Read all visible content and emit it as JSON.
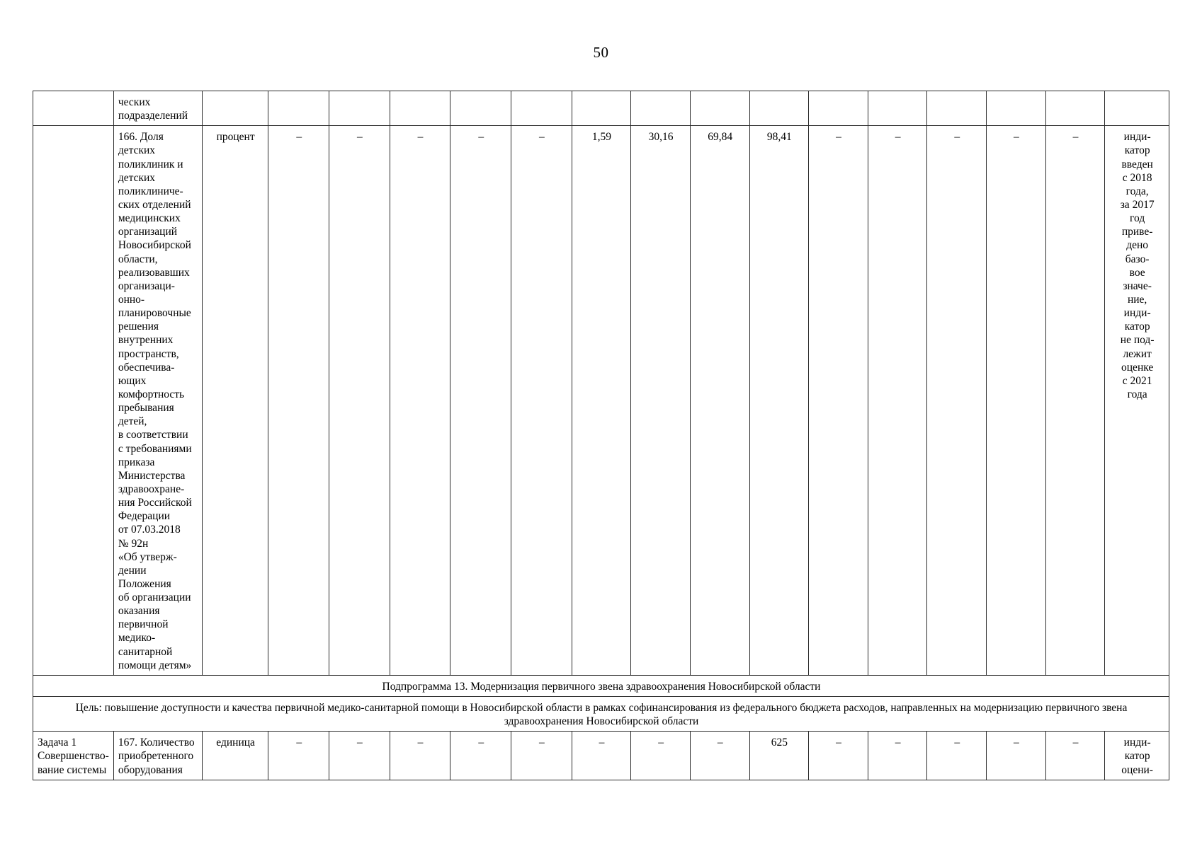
{
  "page": {
    "number": "50"
  },
  "table": {
    "columns": [
      "task",
      "indicator",
      "unit",
      "y1",
      "y2",
      "y3",
      "y4",
      "y5",
      "y6",
      "y7",
      "y8",
      "y9",
      "y10",
      "y11",
      "y12",
      "y13",
      "y14",
      "note"
    ],
    "rows": [
      {
        "id": "row-continuation",
        "task": "",
        "indicator_lines": [
          "ческих",
          "подразделений"
        ],
        "unit": "",
        "values": [
          "",
          "",
          "",
          "",
          "",
          "",
          "",
          "",
          "",
          "",
          "",
          "",
          "",
          ""
        ],
        "note_lines": []
      },
      {
        "id": "row-166",
        "task": "",
        "indicator_lines": [
          "166. Доля",
          "детских",
          "поликлиник и",
          "детских",
          "поликлиниче-",
          "ских отделений",
          "медицинских",
          "организаций",
          "Новосибирской",
          "области,",
          "реализовавших",
          "организаци-",
          "онно-",
          "планировочные",
          "решения",
          "внутренних",
          "пространств,",
          "обеспечива-",
          "ющих",
          "комфортность",
          "пребывания",
          "детей,",
          "в соответствии",
          "с требованиями",
          "приказа",
          "Министерства",
          "здравоохране-",
          "ния Российской",
          "Федерации",
          "от 07.03.2018",
          "№ 92н",
          "«Об утверж-",
          "дении",
          "Положения",
          "об организации",
          "оказания",
          "первичной",
          "медико-",
          "санитарной",
          "помощи детям»"
        ],
        "unit": "процент",
        "values": [
          "–",
          "–",
          "–",
          "–",
          "–",
          "1,59",
          "30,16",
          "69,84",
          "98,41",
          "–",
          "–",
          "–",
          "–",
          "–"
        ],
        "note_lines": [
          "инди-",
          "катор",
          "введен",
          "с 2018",
          "года,",
          "за 2017",
          "год",
          "приве-",
          "дено",
          "базо-",
          "вое",
          "значе-",
          "ние,",
          "инди-",
          "катор",
          "не под-",
          "лежит",
          "оценке",
          "с 2021",
          "года"
        ]
      },
      {
        "id": "row-167",
        "task_lines": [
          "Задача 1",
          "Совершенство-",
          "вание системы"
        ],
        "indicator_lines": [
          "167. Количество",
          "приобретенного",
          "оборудования"
        ],
        "unit": "единица",
        "values": [
          "–",
          "–",
          "–",
          "–",
          "–",
          "–",
          "–",
          "–",
          "625",
          "–",
          "–",
          "–",
          "–",
          "–"
        ],
        "note_lines": [
          "инди-",
          "катор",
          "оцени-"
        ]
      }
    ],
    "subprogram_row": {
      "text": "Подпрограмма 13. Модернизация первичного звена здравоохранения Новосибирской области"
    },
    "goal_row": {
      "line1": "Цель: повышение доступности и качества первичной медико-санитарной помощи в Новосибирской области в рамках софинансирования из федерального бюджета расходов, направленных на модернизацию первичного звена",
      "line2": "здравоохранения Новосибирской области"
    }
  }
}
